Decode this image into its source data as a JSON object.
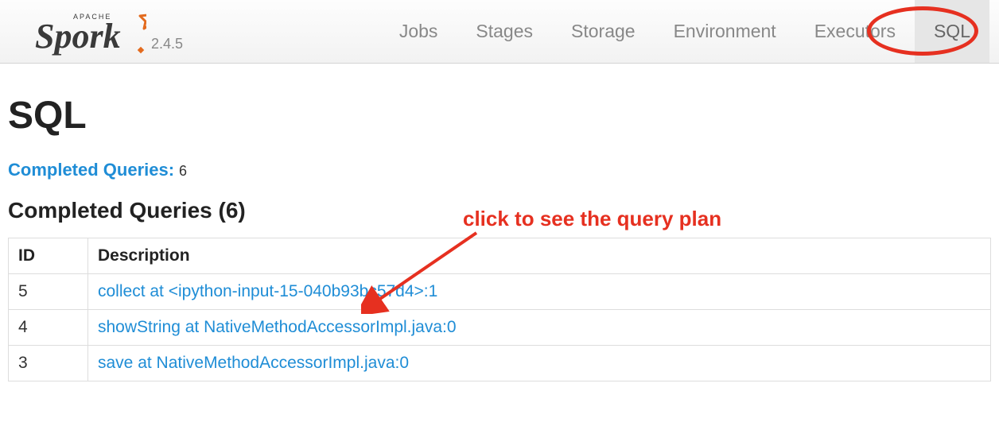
{
  "brand": {
    "tagline": "APACHE",
    "name": "Spark",
    "version": "2.4.5"
  },
  "nav": {
    "items": [
      {
        "label": "Jobs"
      },
      {
        "label": "Stages"
      },
      {
        "label": "Storage"
      },
      {
        "label": "Environment"
      },
      {
        "label": "Executors"
      },
      {
        "label": "SQL"
      }
    ],
    "activeIndex": 5
  },
  "page": {
    "title": "SQL",
    "sectionLink": "Completed Queries:",
    "sectionCount": "6",
    "tableHeading": "Completed Queries (6)"
  },
  "table": {
    "headers": {
      "id": "ID",
      "description": "Description"
    },
    "rows": [
      {
        "id": "5",
        "description": "collect at <ipython-input-15-040b93bc57d4>:1"
      },
      {
        "id": "4",
        "description": "showString at NativeMethodAccessorImpl.java:0"
      },
      {
        "id": "3",
        "description": "save at NativeMethodAccessorImpl.java:0"
      }
    ]
  },
  "annotation": {
    "text": "click to see the query plan"
  }
}
